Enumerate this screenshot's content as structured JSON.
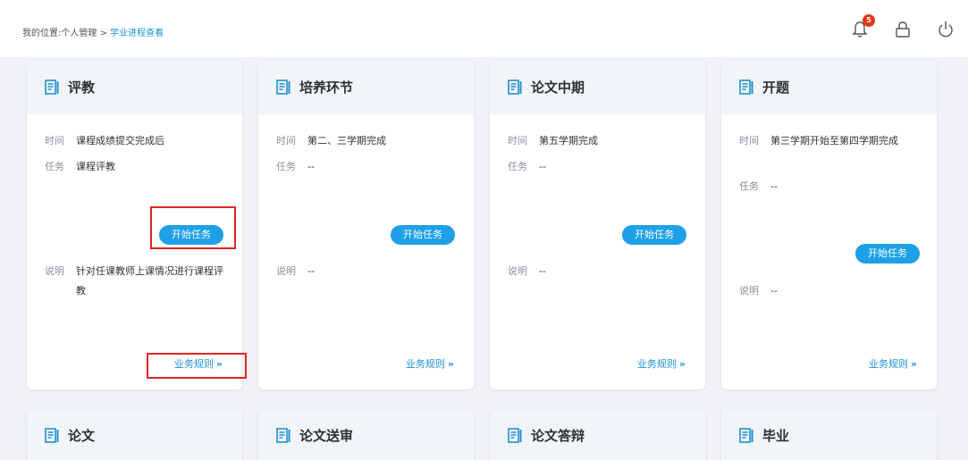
{
  "breadcrumb": {
    "prefix": "我的位置:个人管理 > ",
    "current": "学业进程查看"
  },
  "header": {
    "notification_count": "5",
    "colors": {
      "badge": "#e8341c",
      "accent": "#1e90d6"
    }
  },
  "labels": {
    "time": "时间",
    "task": "任务",
    "note": "说明"
  },
  "cards": [
    {
      "title": "评教",
      "time": "课程成绩提交完成后",
      "task": "课程评教",
      "button": "开始任务",
      "note": "针对任课教师上课情况进行课程评教",
      "rule": "业务规则"
    },
    {
      "title": "培养环节",
      "time": "第二、三学期完成",
      "task": "--",
      "button": "开始任务",
      "note": "--",
      "rule": "业务规则"
    },
    {
      "title": "论文中期",
      "time": "第五学期完成",
      "task": "--",
      "button": "开始任务",
      "note": "--",
      "rule": "业务规则"
    },
    {
      "title": "开题",
      "time": "第三学期开始至第四学期完成",
      "task": "--",
      "button": "开始任务",
      "note": "--",
      "rule": "业务规则"
    },
    {
      "title": "论文"
    },
    {
      "title": "论文送审"
    },
    {
      "title": "论文答辩"
    },
    {
      "title": "毕业"
    }
  ],
  "icons": {
    "doc": "document-icon",
    "bell": "bell-icon",
    "lock": "lock-icon",
    "power": "power-icon",
    "arrows": "double-chevron-right-icon"
  }
}
